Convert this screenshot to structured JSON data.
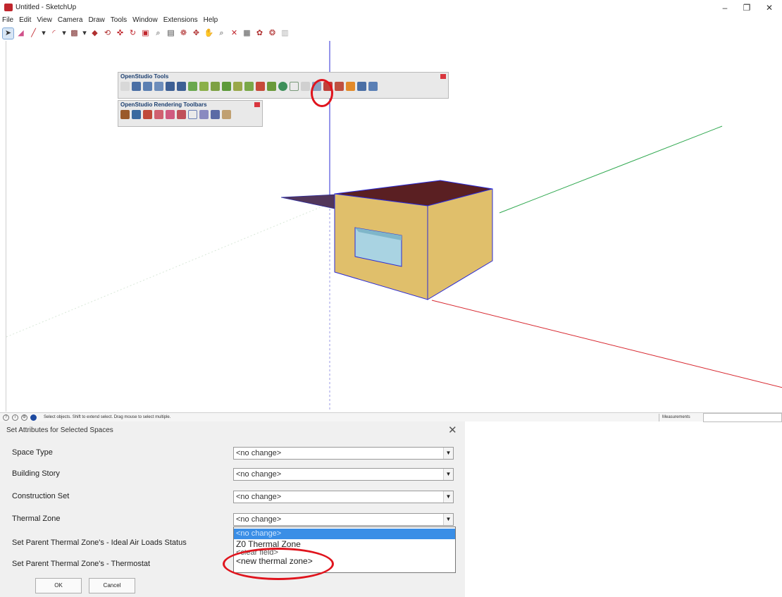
{
  "window": {
    "title": "Untitled - SketchUp",
    "minimize": "–",
    "maximize": "❐",
    "close": "✕"
  },
  "menu": [
    "File",
    "Edit",
    "View",
    "Camera",
    "Draw",
    "Tools",
    "Window",
    "Extensions",
    "Help"
  ],
  "toolbars": {
    "openstudio_tools": {
      "title": "OpenStudio Tools"
    },
    "openstudio_rendering": {
      "title": "OpenStudio Rendering Toolbars"
    }
  },
  "status": {
    "text": "Select objects. Shift to extend select. Drag mouse to select multiple.",
    "measurements_label": "Measurements",
    "icons": [
      "?",
      "i",
      "⚙",
      "●"
    ]
  },
  "dialog": {
    "title": "Set Attributes for Selected Spaces",
    "close": "✕",
    "rows": [
      {
        "label": "Space Type",
        "value": "<no change>"
      },
      {
        "label": "Building Story",
        "value": "<no change>"
      },
      {
        "label": "Construction Set",
        "value": "<no change>"
      },
      {
        "label": "Thermal Zone",
        "value": "<no change>"
      },
      {
        "label": "Set Parent Thermal Zone's - Ideal Air Loads Status",
        "value": ""
      },
      {
        "label": "Set Parent Thermal Zone's - Thermostat",
        "value": ""
      }
    ],
    "dropdown_options": [
      "<no change>",
      "Z0 Thermal Zone",
      "<clear field>",
      "<new thermal zone>"
    ],
    "ok_label": "OK",
    "cancel_label": "Cancel"
  },
  "colors": {
    "annotation": "#e0141d",
    "highlight": "#3a8ee6",
    "wall": "#e0bf6b",
    "roof": "#5a1f22",
    "window": "#a9d3e2",
    "axis_blue": "#2b2bd6",
    "axis_green": "#2fa84f",
    "axis_red": "#d7262e"
  }
}
